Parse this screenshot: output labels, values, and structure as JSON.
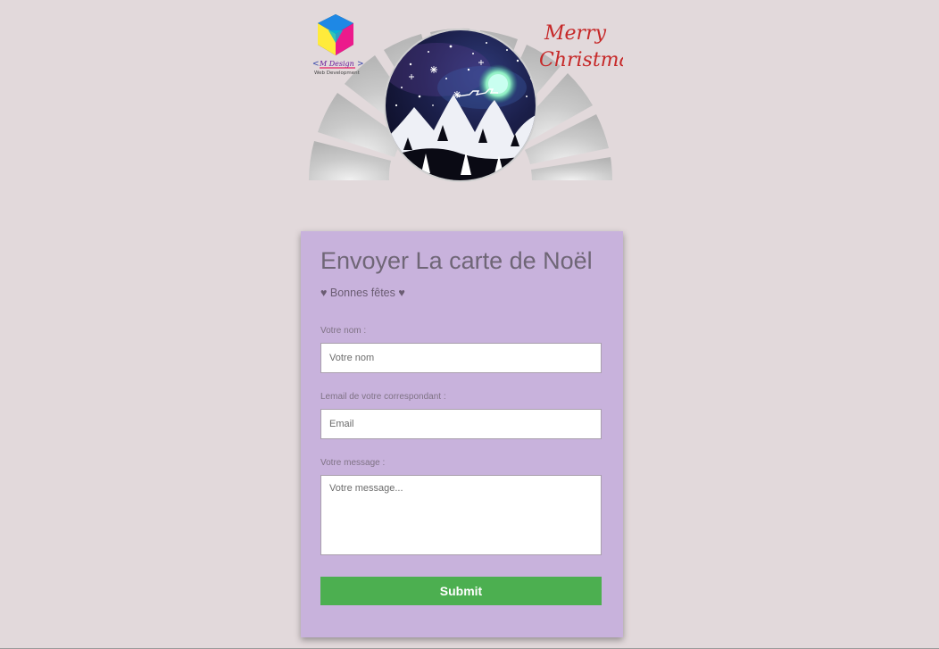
{
  "header": {
    "brand_logo_icon": "hexagon-cmyk-logo",
    "brand_name": "M Design",
    "brand_tagline": "Web Development",
    "greeting_script": "Merry Christmas",
    "banner_icon": "winter-night-scene-globe"
  },
  "form": {
    "title": "Envoyer La carte de Noël",
    "subtitle": "♥ Bonnes fêtes ♥",
    "name_label": "Votre nom :",
    "name_placeholder": "Votre nom",
    "email_label": "Lemail de votre correspondant :",
    "email_placeholder": "Email",
    "message_label": "Votre message :",
    "message_placeholder": "Votre message...",
    "submit_label": "Submit"
  },
  "colors": {
    "page_background": "#e2d9db",
    "card_background": "#c8b2dc",
    "submit_button": "#4caf50",
    "script_red": "#c62828"
  }
}
